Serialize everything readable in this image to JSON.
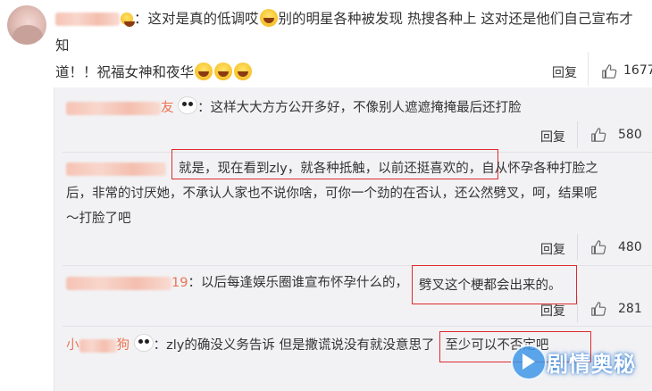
{
  "main_comment": {
    "text_part1": "：这对是真的低调哎",
    "text_part2": "别的明星各种被发现 热搜各种上 这对还是他们自己宣布才知",
    "text_line2": "道！！祝福女神和夜华",
    "reply_label": "回复",
    "like_count": "1677"
  },
  "replies": [
    {
      "user_suffix": "友",
      "text": "：这样大大方方公开多好，不像别人遮遮掩掩最后还打脸",
      "reply_label": "回复",
      "like_count": "580"
    },
    {
      "line1_highlight": "就是，现在看到zly，就各种抵触，以前还挺喜欢的，",
      "line1_rest": "自从怀孕各种打脸之",
      "line2": "后，非常的讨厌她，不承认人家也不说你啥，可你一个劲的在否认，还公然劈叉，呵，结果呢",
      "line3": "～打脸了吧",
      "reply_label": "回复",
      "like_count": "480"
    },
    {
      "user_suffix": "19",
      "text": "：以后每逢娱乐圈谁宣布怀孕什么的，",
      "text_highlight": "劈叉这个梗都会出来的。",
      "reply_label": "回复",
      "like_count": "281"
    },
    {
      "user_prefix": "小",
      "user_suffix": "狗",
      "text": "：zly的确没义务告诉 但是撒谎说没有就没意思了",
      "text_highlight": "至少可以不否定吧"
    }
  ],
  "watermark": {
    "text": "剧情奥秘",
    "color": "#4096e6"
  },
  "colors": {
    "username": "#eb7350",
    "highlight_box": "#e02a2a",
    "panel_bg": "#f2f2f5"
  },
  "icons": [
    "panda-emoji",
    "laugh-emoji",
    "like-icon"
  ]
}
